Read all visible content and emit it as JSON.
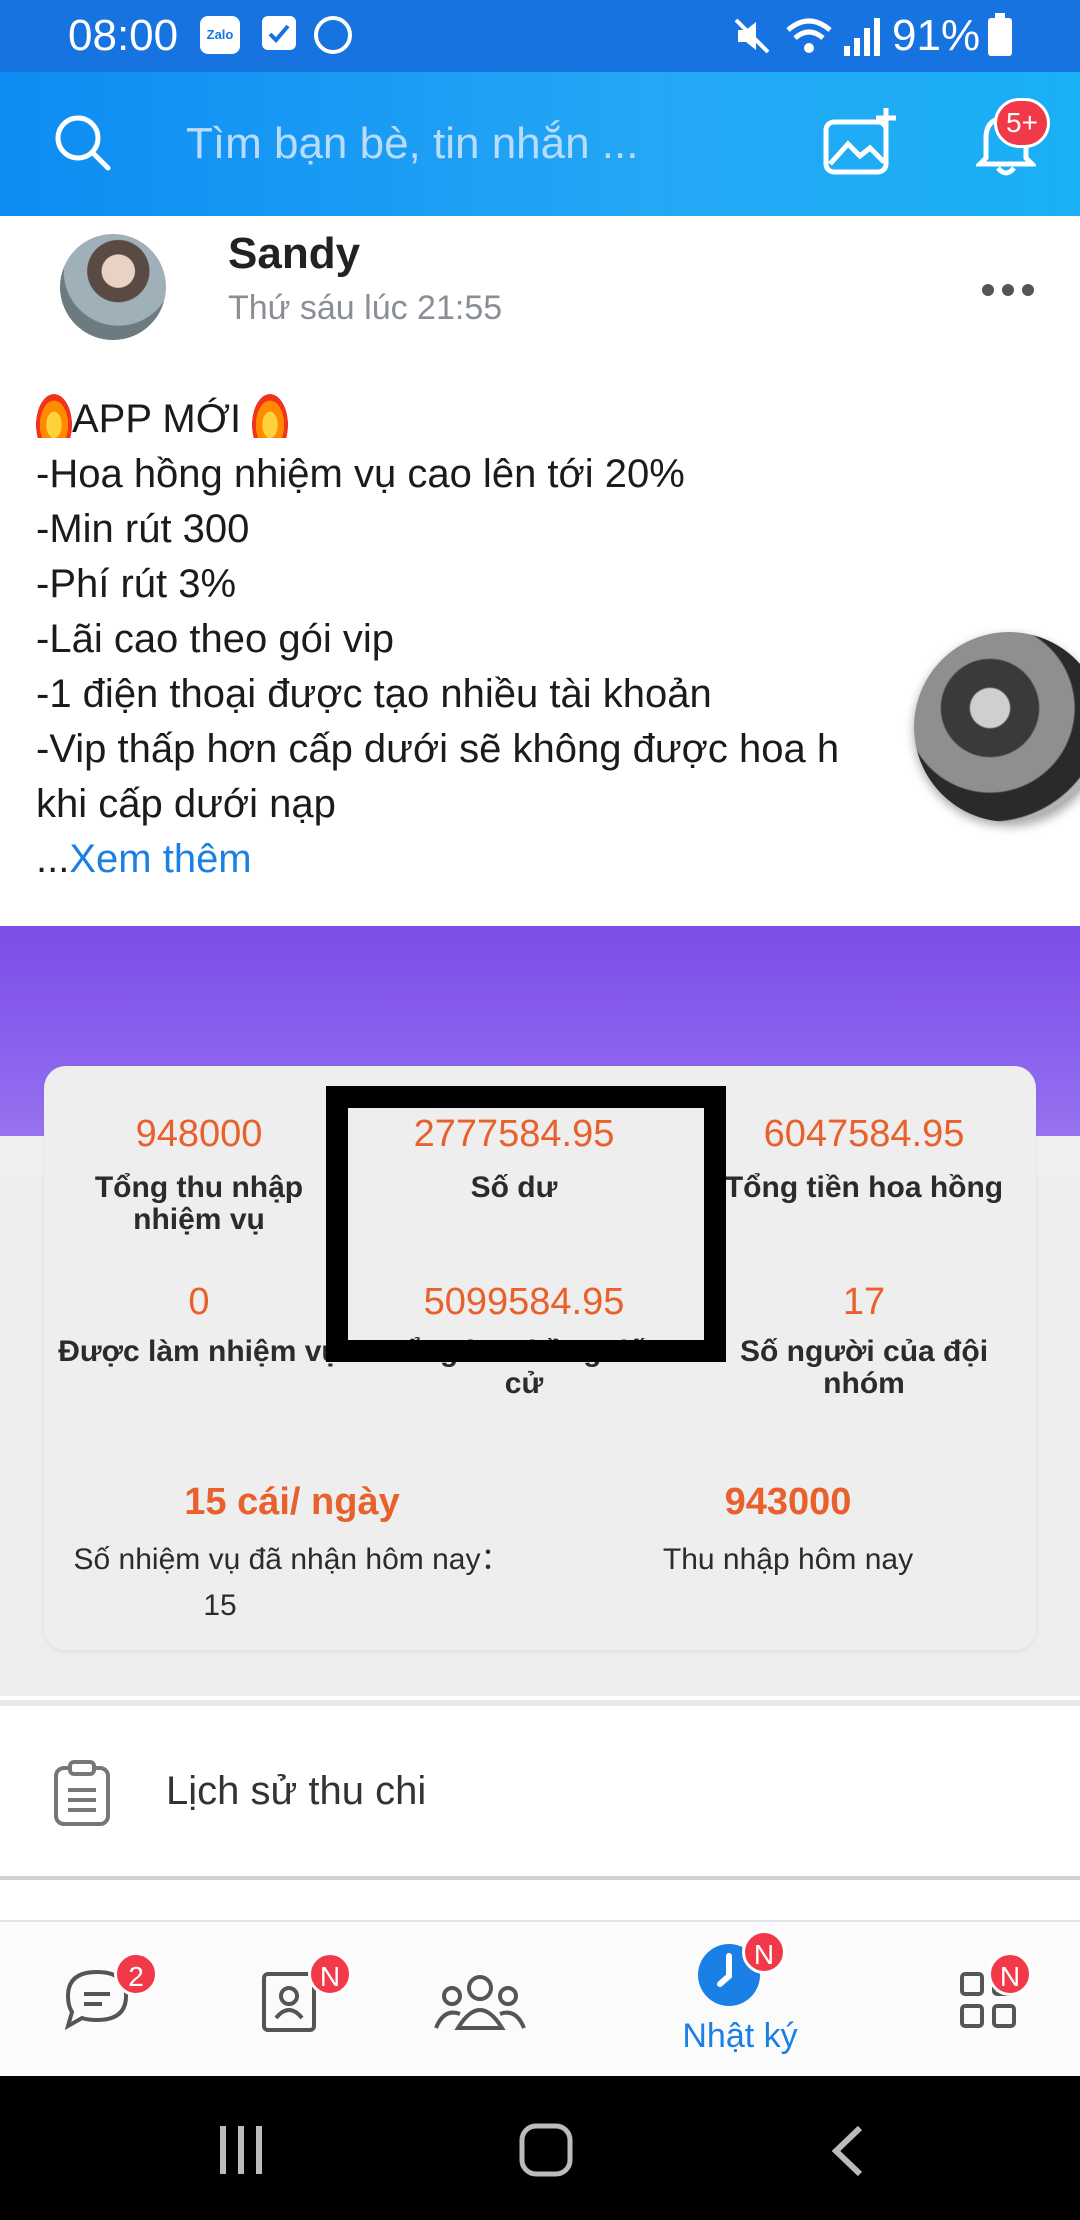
{
  "status_bar": {
    "time": "08:00",
    "battery": "91%",
    "icons": [
      "zalo-icon",
      "checkbox-app-icon",
      "messenger-icon",
      "mute-icon",
      "wifi-icon",
      "signal-icon",
      "battery-icon"
    ]
  },
  "header": {
    "search_placeholder": "Tìm bạn bè, tin nhắn ...",
    "notification_badge": "5+",
    "colors": {
      "start": "#0d8cf3",
      "end": "#1ab0f5"
    }
  },
  "post": {
    "author": "Sandy",
    "time": "Thứ sáu lúc 21:55",
    "title": "APP MỚI",
    "lines": [
      "-Hoa hồng nhiệm vụ cao lên tới 20%",
      "-Min rút 300",
      "-Phí rút 3%",
      "-Lãi cao theo gói vip",
      "-1 điện thoại được tạo nhiều tài khoản",
      "-Vip thấp hơn cấp dưới sẽ không được hoa h",
      "khi cấp dưới nạp"
    ],
    "see_more_prefix": "...",
    "see_more": "Xem thêm"
  },
  "stats_image": {
    "row1": [
      {
        "value": "948000",
        "label": "Tổng thu nhập nhiệm vụ",
        "label_line1": "Tổng thu nhập",
        "label_line2": "nhiệm vụ"
      },
      {
        "value": "2777584.95",
        "label": "Số dư"
      },
      {
        "value": "6047584.95",
        "label": "Tổng tiền hoa hồng"
      }
    ],
    "row2": [
      {
        "value": "0",
        "label": "Được làm nhiệm vụ"
      },
      {
        "value": "5099584.95",
        "label": "Tổng hoa hồng tiến cử",
        "label_line1": "Tổng hoa hồng tiến",
        "label_line2": "cử"
      },
      {
        "value": "17",
        "label": "Số người của đội nhóm",
        "label_line1": "Số người của đội",
        "label_line2": "nhóm"
      }
    ],
    "row3": [
      {
        "value": "15 cái/ ngày",
        "label": "Số nhiệm vụ đã nhận hôm nay：",
        "sub": "15"
      },
      {
        "value": "943000",
        "label": "Thu nhập hôm nay"
      }
    ],
    "accent_color": "#e8612c",
    "header_color": "#7b4de8"
  },
  "history": {
    "label": "Lịch sử thu chi"
  },
  "bottom_nav": {
    "items": [
      {
        "icon": "chat-icon",
        "badge": "2"
      },
      {
        "icon": "contacts-icon",
        "badge": "N"
      },
      {
        "icon": "groups-icon"
      },
      {
        "icon": "timeline-icon",
        "badge": "N",
        "label": "Nhật ký",
        "active": true
      },
      {
        "icon": "apps-grid-icon",
        "badge": "N"
      }
    ]
  }
}
